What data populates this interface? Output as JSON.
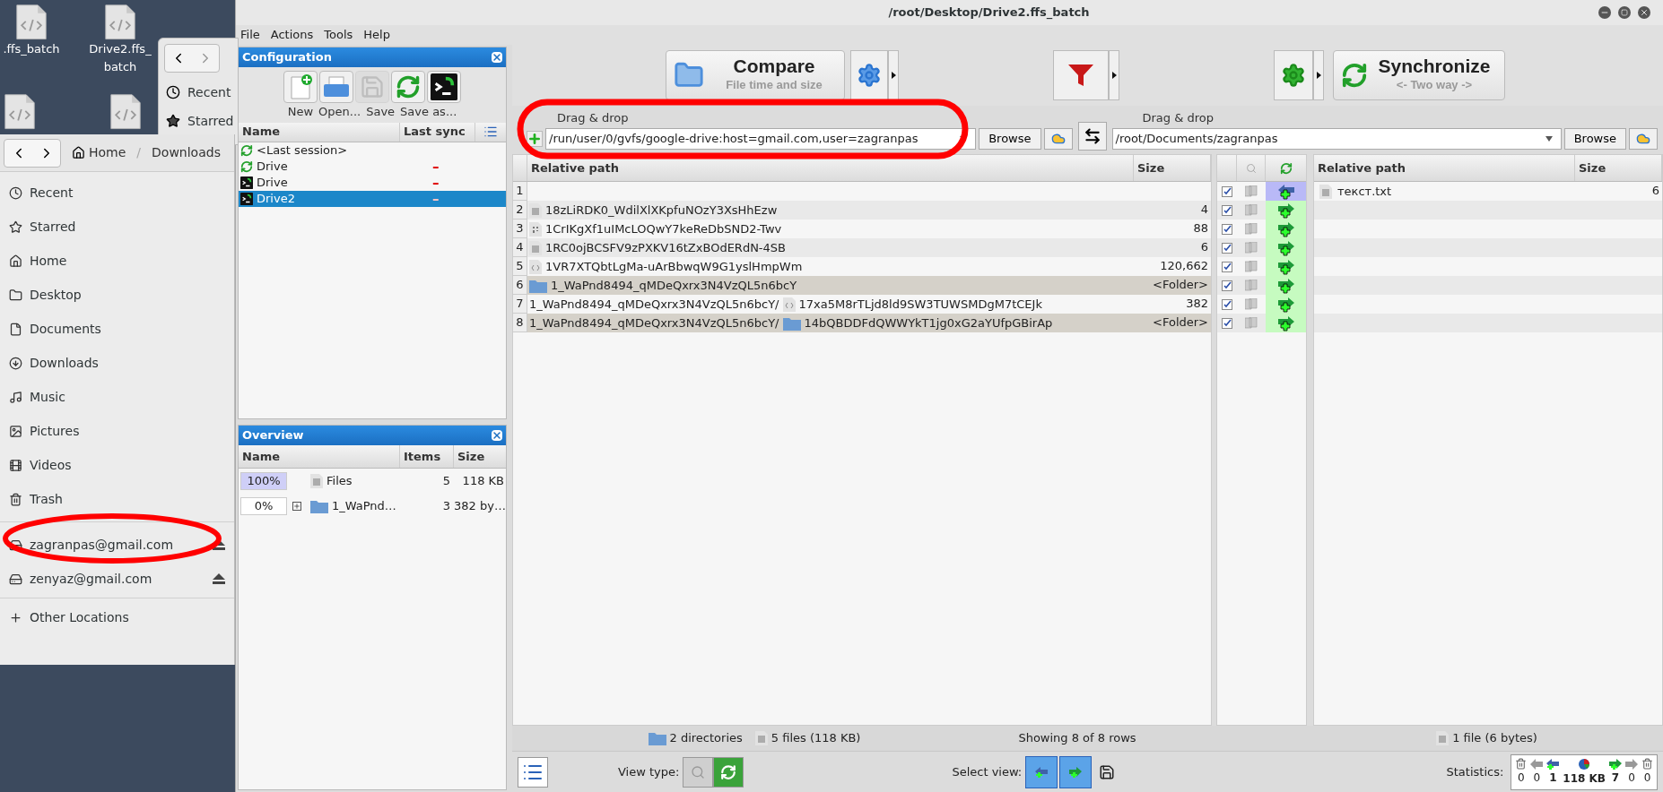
{
  "desktop": {
    "icons": [
      {
        "label": ".ffs_batch"
      },
      {
        "label": "Drive2.ffs_batch"
      }
    ]
  },
  "back_window": {
    "places": [
      "Recent",
      "Starred"
    ]
  },
  "file_manager": {
    "breadcrumb": [
      "Home",
      "Downloads"
    ],
    "breadcrumb_separator": "/",
    "places": [
      "Recent",
      "Starred",
      "Home",
      "Desktop",
      "Documents",
      "Downloads",
      "Music",
      "Pictures",
      "Videos",
      "Trash"
    ],
    "drives": [
      {
        "label": "zagranpas@gmail.com"
      },
      {
        "label": "zenyaz@gmail.com"
      }
    ],
    "other_locations": "Other Locations"
  },
  "window": {
    "title": "/root/Desktop/Drive2.ffs_batch"
  },
  "menu": [
    "File",
    "Actions",
    "Tools",
    "Help"
  ],
  "configuration": {
    "title": "Configuration",
    "tools": [
      {
        "kind": "new",
        "disabled": false
      },
      {
        "kind": "open",
        "disabled": false
      },
      {
        "kind": "save",
        "disabled": true
      },
      {
        "kind": "save_as",
        "disabled": false
      },
      {
        "kind": "save_batch",
        "disabled": false
      }
    ],
    "tool_labels": [
      "New",
      "Open...",
      "Save",
      "Save as..."
    ],
    "columns": [
      "Name",
      "Last sync"
    ],
    "items": [
      {
        "name": "<Last session>",
        "kind": "sync",
        "selected": false
      },
      {
        "name": "Drive",
        "kind": "sync",
        "last_sync": "–",
        "selected": false
      },
      {
        "name": "Drive",
        "kind": "batch",
        "last_sync": "–",
        "selected": false
      },
      {
        "name": "Drive2",
        "kind": "batch",
        "last_sync": "–",
        "selected": true
      }
    ]
  },
  "overview": {
    "title": "Overview",
    "columns": [
      "Name",
      "Items",
      "Size"
    ],
    "rows": [
      {
        "percent": "100%",
        "level": 1,
        "name": "Files",
        "kind": "files",
        "items": "5",
        "size": "118 KB",
        "expandable": false
      },
      {
        "percent": "0%",
        "level": 0,
        "name": "1_WaPnd…",
        "kind": "folder",
        "items": "3",
        "size": "382 by…",
        "expandable": true
      }
    ]
  },
  "toolbar": {
    "compare": {
      "label": "Compare",
      "sub": "File time and size"
    },
    "synchronize": {
      "label": "Synchronize",
      "sub": "<- Two way ->"
    }
  },
  "folders": {
    "left": {
      "label": "Drag & drop",
      "path": "/run/user/0/gvfs/google-drive:host=gmail.com,user=zagranpas",
      "browse": "Browse"
    },
    "right": {
      "label": "Drag & drop",
      "path": "/root/Documents/zagranpas",
      "browse": "Browse"
    }
  },
  "grid": {
    "left_columns": [
      "Relative path",
      "Size"
    ],
    "right_columns": [
      "Relative path",
      "Size"
    ],
    "rows": [
      {
        "number": "1",
        "checked": true,
        "kind": "create_left",
        "right": {
          "kind": "text",
          "name": "текст.txt",
          "size": "6"
        }
      },
      {
        "number": "2",
        "checked": true,
        "kind": "create_right",
        "left": {
          "kind": "text",
          "name": "18zLiRDK0_WdilXlXKpfuNOzY3XsHhEzw",
          "size": "4"
        }
      },
      {
        "number": "3",
        "checked": true,
        "kind": "create_right",
        "left": {
          "kind": "binary",
          "name": "1CrIKgXf1uIMcLOQwY7keReDbSND2-Twv",
          "size": "88"
        }
      },
      {
        "number": "4",
        "checked": true,
        "kind": "create_right",
        "left": {
          "kind": "text",
          "name": "1RC0ojBCSFV9zPXKV16tZxBOdERdN-4SB",
          "size": "6"
        }
      },
      {
        "number": "5",
        "checked": true,
        "kind": "create_right",
        "left": {
          "kind": "code",
          "name": "1VR7XTQbtLgMa-uArBbwqW9G1yslHmpWm",
          "size": "120,662"
        }
      },
      {
        "number": "6",
        "checked": true,
        "kind": "create_right",
        "left": {
          "kind": "folder",
          "name": "1_WaPnd8494_qMDeQxrx3N4VzQL5n6bcY",
          "size": "<Folder>"
        }
      },
      {
        "number": "7",
        "checked": true,
        "kind": "create_right",
        "left": {
          "kind": "code",
          "parent": "1_WaPnd8494_qMDeQxrx3N4VzQL5n6bcY/",
          "name": "17xa5M8rTLjd8ld9SW3TUWSMDgM7tCEJk",
          "size": "382"
        }
      },
      {
        "number": "8",
        "checked": true,
        "kind": "create_right",
        "left": {
          "kind": "folder",
          "parent": "1_WaPnd8494_qMDeQxrx3N4VzQL5n6bcY/",
          "name": "14bQBDDFdQWWYkT1jg0xG2aYUfpGBirAp",
          "size": "<Folder>"
        }
      }
    ]
  },
  "status_bar": {
    "directories": "2 directories",
    "files": "5 files (118 KB)",
    "rows": "Showing 8 of 8 rows",
    "right_files": "1 file (6 bytes)"
  },
  "bottom": {
    "view_type_label": "View type:",
    "view_types": [
      {
        "kind": "files",
        "selected": false
      },
      {
        "kind": "actions",
        "selected": true
      }
    ],
    "select_view_label": "Select view:",
    "select_views": [
      {
        "kind": "create_left",
        "selected": true
      },
      {
        "kind": "create_right",
        "selected": true
      }
    ],
    "statistics_label": "Statistics:",
    "statistics": [
      {
        "kind": "delete_left",
        "value": "0"
      },
      {
        "kind": "update_left",
        "value": "0"
      },
      {
        "kind": "create_left",
        "value": "1"
      },
      {
        "kind": "data",
        "value": "118 KB"
      },
      {
        "kind": "create_right",
        "value": "7"
      },
      {
        "kind": "update_right",
        "value": "0"
      },
      {
        "kind": "delete_right",
        "value": "0"
      }
    ]
  }
}
